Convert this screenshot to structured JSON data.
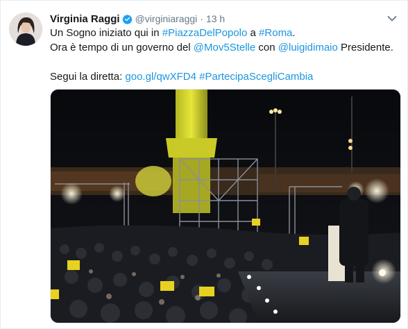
{
  "tweet": {
    "author_name": "Virginia Raggi",
    "handle": "@virginiaraggi",
    "separator": "·",
    "time": "13 h",
    "line1": {
      "t1": "Un Sogno iniziato qui in ",
      "tag1": "#PiazzaDelPopolo",
      "t2": " a ",
      "tag2": "#Roma",
      "t3": "."
    },
    "line2": {
      "t1": "Ora è tempo di un governo del ",
      "mention1": "@Mov5Stelle",
      "t2": " con ",
      "mention2": "@luigidimaio",
      "t3": " Presidente."
    },
    "line3": {
      "t1": "Segui la diretta: ",
      "link": "goo.gl/qwXFD4",
      "t2": " ",
      "tag": "#PartecipaScegliCambia"
    }
  },
  "colors": {
    "link": "#1b95e0",
    "verified": "#1da1f2",
    "muted": "#657786",
    "text": "#14171a"
  },
  "icons": {
    "verified": "verified-badge-icon",
    "caret": "chevron-down-icon"
  }
}
